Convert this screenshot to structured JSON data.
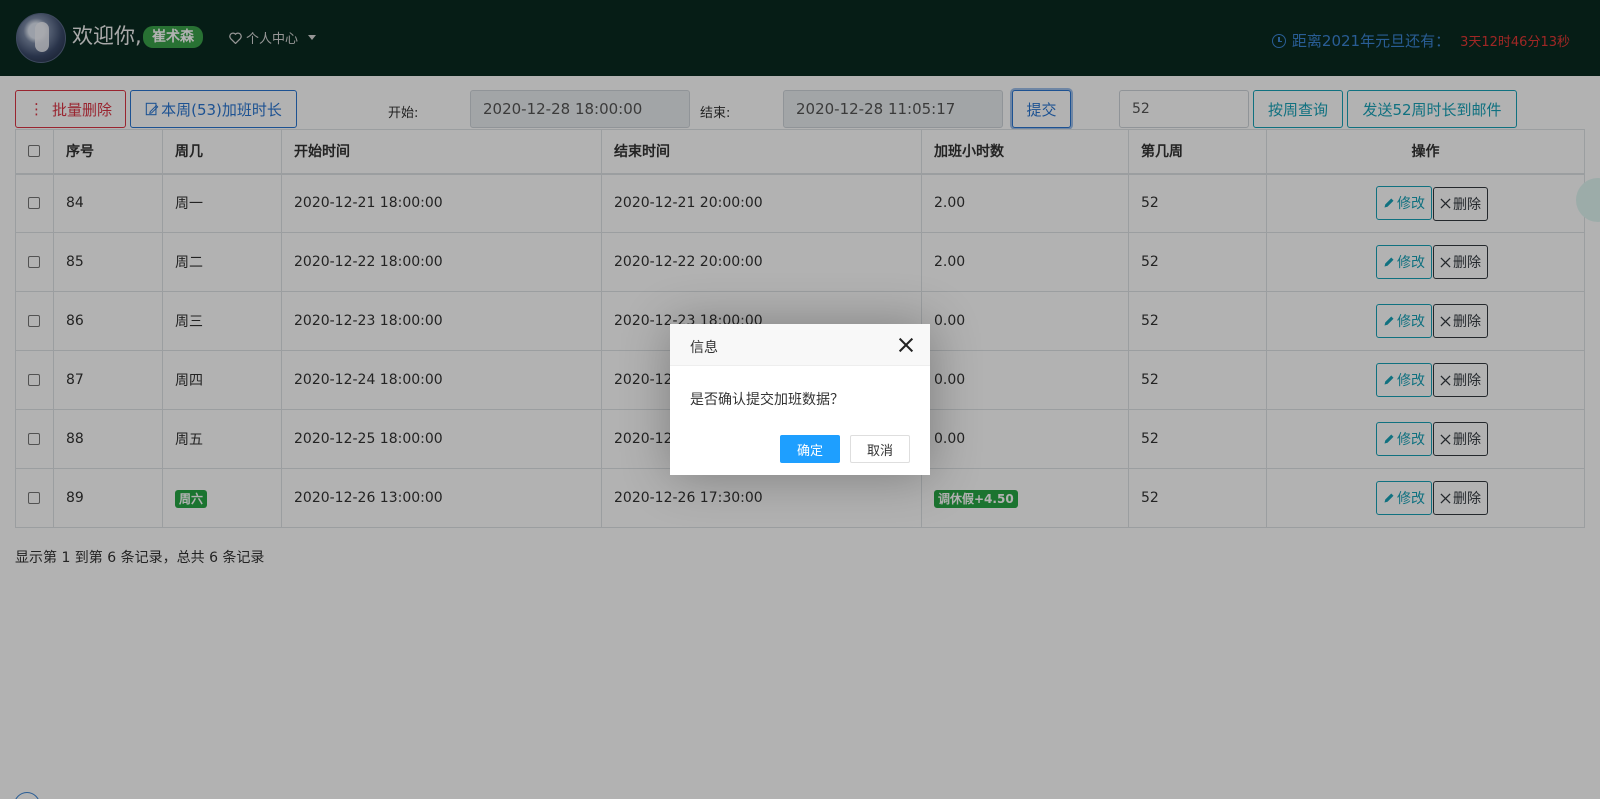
{
  "header": {
    "welcome": "欢迎你,",
    "user_name": "崔术森",
    "personal_center": "个人中心",
    "countdown_label": "距离2021年元旦还有：",
    "countdown_value": "3天12时46分13秒"
  },
  "toolbar": {
    "batch_delete": "批量删除",
    "weekly_overtime": "本周(53)加班时长",
    "start_label": "开始:",
    "start_value": "2020-12-28 18:00:00",
    "end_label": "结束:",
    "end_value": "2020-12-28 11:05:17",
    "submit": "提交",
    "week_value": "52",
    "query_by_week": "按周查询",
    "send_email": "发送52周时长到邮件"
  },
  "table": {
    "headers": [
      "序号",
      "周几",
      "开始时间",
      "结束时间",
      "加班小时数",
      "第几周",
      "操作"
    ],
    "rows": [
      {
        "id": "84",
        "day": "周一",
        "start": "2020-12-21 18:00:00",
        "end": "2020-12-21 20:00:00",
        "hours": "2.00",
        "week": "52"
      },
      {
        "id": "85",
        "day": "周二",
        "start": "2020-12-22 18:00:00",
        "end": "2020-12-22 20:00:00",
        "hours": "2.00",
        "week": "52"
      },
      {
        "id": "86",
        "day": "周三",
        "start": "2020-12-23 18:00:00",
        "end": "2020-12-23 18:00:00",
        "hours": "0.00",
        "week": "52"
      },
      {
        "id": "87",
        "day": "周四",
        "start": "2020-12-24 18:00:00",
        "end": "2020-12-",
        "hours": "0.00",
        "week": "52"
      },
      {
        "id": "88",
        "day": "周五",
        "start": "2020-12-25 18:00:00",
        "end": "2020-12-",
        "hours": "0.00",
        "week": "52"
      },
      {
        "id": "89",
        "day": "周六",
        "start": "2020-12-26 13:00:00",
        "end": "2020-12-26 17:30:00",
        "hours": "调休假+4.50",
        "week": "52"
      }
    ],
    "edit_label": "修改",
    "delete_label": "删除",
    "summary": "显示第 1 到第 6 条记录，总共 6 条记录"
  },
  "dialog": {
    "title": "信息",
    "message": "是否确认提交加班数据？",
    "confirm": "确定",
    "cancel": "取消"
  }
}
